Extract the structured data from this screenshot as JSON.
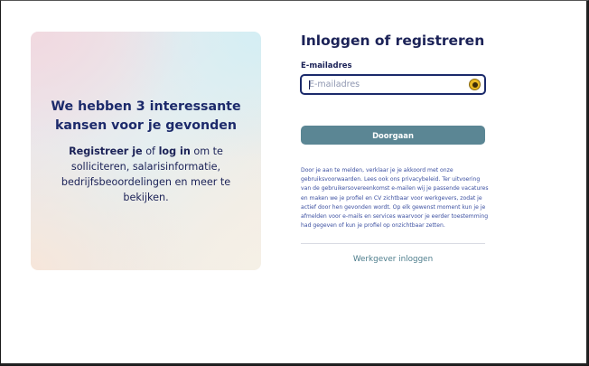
{
  "promo": {
    "title": "We hebben 3 interessante kansen voor je gevonden",
    "register_text": "Registreer je",
    "or_text": " of ",
    "login_text": "log in",
    "rest_text": " om te solliciteren, salarisinformatie, bedrijfsbeoordelingen en meer te bekijken."
  },
  "login": {
    "heading": "Inloggen of registreren",
    "email_label": "E-mailadres",
    "email_placeholder": "E-mailadres",
    "email_value": "",
    "continue_label": "Doorgaan",
    "legal_text": "Door je aan te melden, verklaar je je akkoord met onze gebruiksvoorwaarden. Lees ook ons privacybeleid. Ter uitvoering van de gebruikersovereenkomst e-mailen wij je passende vacatures en maken we je profiel en CV zichtbaar voor werkgevers, zodat je actief door hen gevonden wordt. Op elk gewenst moment kun je je afmelden voor e-mails en services waarvoor je eerder toestemming had gegeven of kun je profiel op onzichtbaar zetten.",
    "employer_login": "Werkgever inloggen"
  },
  "icons": {
    "password_manager": "password-manager-icon"
  },
  "colors": {
    "primary_text": "#1b2257",
    "button": "#5b8694",
    "link": "#4d7d8c",
    "legal": "#3b4fa0"
  }
}
